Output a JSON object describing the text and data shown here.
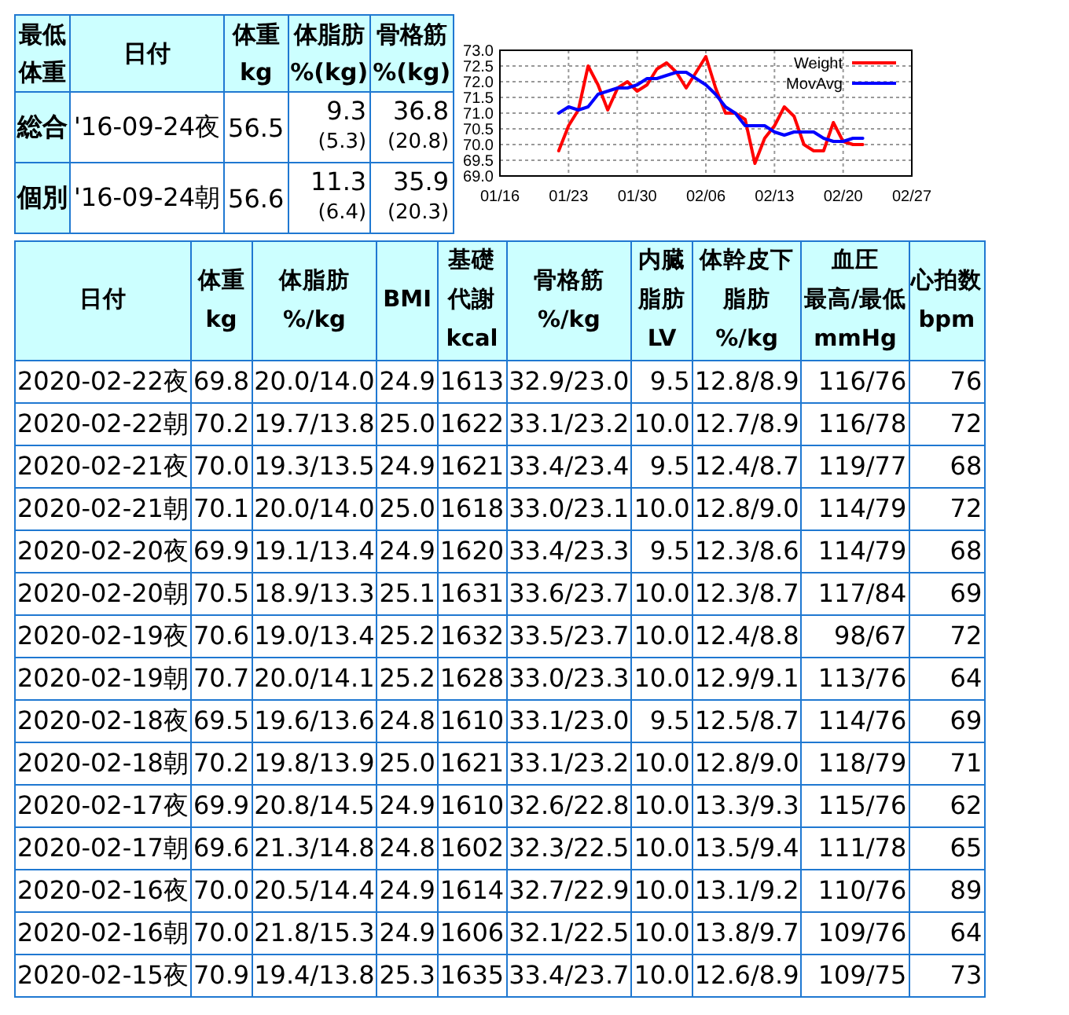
{
  "summary_table": {
    "corner": {
      "lines": [
        "最低",
        "体重"
      ]
    },
    "columns": [
      {
        "lines": [
          "日付"
        ]
      },
      {
        "lines": [
          "体重",
          "kg"
        ]
      },
      {
        "lines": [
          "体脂肪",
          "%(kg)"
        ]
      },
      {
        "lines": [
          "骨格筋",
          "%(kg)"
        ]
      }
    ],
    "rows": [
      {
        "label": "総合",
        "date": "'16-09-24夜",
        "weight": "56.5",
        "fat": "9.3",
        "fat_kg": "(5.3)",
        "muscle": "36.8",
        "muscle_kg": "(20.8)"
      },
      {
        "label": "個別",
        "date": "'16-09-24朝",
        "weight": "56.6",
        "fat": "11.3",
        "fat_kg": "(6.4)",
        "muscle": "35.9",
        "muscle_kg": "(20.3)"
      }
    ]
  },
  "chart": {
    "chart_data": {
      "type": "line",
      "grid": true,
      "legend": true,
      "categories": [
        "01/16",
        null,
        null,
        null,
        null,
        null,
        null,
        "01/23",
        null,
        null,
        null,
        null,
        null,
        null,
        "01/30",
        null,
        null,
        null,
        null,
        null,
        null,
        "02/06",
        null,
        null,
        null,
        null,
        null,
        null,
        "02/13",
        null,
        null,
        null,
        null,
        null,
        null,
        "02/20",
        null,
        null,
        null,
        null,
        null,
        null,
        "02/27"
      ],
      "series": [
        {
          "name": "Weight",
          "color": "#ff0000",
          "values": [
            null,
            null,
            null,
            null,
            null,
            null,
            69.8,
            70.6,
            71.1,
            72.5,
            71.9,
            71.1,
            71.8,
            72.0,
            71.7,
            71.9,
            72.4,
            72.6,
            72.3,
            71.8,
            72.3,
            72.8,
            71.8,
            71.0,
            71.0,
            70.8,
            69.4,
            70.2,
            70.6,
            71.2,
            70.9,
            70.0,
            69.8,
            69.8,
            70.7,
            70.1,
            70.0,
            70.0,
            null,
            null,
            null,
            null,
            null
          ]
        },
        {
          "name": "MovAvg",
          "color": "#0000ff",
          "values": [
            null,
            null,
            null,
            null,
            null,
            null,
            71.0,
            71.2,
            71.1,
            71.2,
            71.6,
            71.7,
            71.8,
            71.8,
            71.9,
            72.1,
            72.1,
            72.2,
            72.3,
            72.3,
            72.1,
            71.9,
            71.6,
            71.2,
            71.0,
            70.6,
            70.6,
            70.6,
            70.4,
            70.3,
            70.4,
            70.4,
            70.4,
            70.2,
            70.1,
            70.1,
            70.2,
            70.2,
            null,
            null,
            null,
            null,
            null
          ]
        }
      ],
      "ylim": [
        69.0,
        73.0
      ],
      "yticks": [
        {
          "value": 69.0,
          "label": "69.0"
        },
        {
          "value": 69.5,
          "label": "69.5"
        },
        {
          "value": 70.0,
          "label": "70.0"
        },
        {
          "value": 70.5,
          "label": "70.5"
        },
        {
          "value": 71.0,
          "label": "71.0"
        },
        {
          "value": 71.5,
          "label": "71.5"
        },
        {
          "value": 72.0,
          "label": "72.0"
        },
        {
          "value": 72.5,
          "label": "72.5"
        },
        {
          "value": 73.0,
          "label": "73.0"
        }
      ]
    }
  },
  "log_table": {
    "columns": [
      {
        "lines": [
          "日付"
        ]
      },
      {
        "lines": [
          "体重",
          "kg"
        ]
      },
      {
        "lines": [
          "体脂肪",
          "%/kg"
        ]
      },
      {
        "lines": [
          "BMI"
        ]
      },
      {
        "lines": [
          "基礎",
          "代謝",
          "kcal"
        ]
      },
      {
        "lines": [
          "骨格筋",
          "%/kg"
        ]
      },
      {
        "lines": [
          "内臓",
          "脂肪",
          "LV"
        ]
      },
      {
        "lines": [
          "体幹皮下",
          "脂肪",
          "%/kg"
        ]
      },
      {
        "lines": [
          "血圧",
          "最高/最低",
          "mmHg"
        ]
      },
      {
        "lines": [
          "心拍数",
          "bpm"
        ]
      }
    ],
    "rows": [
      [
        "2020-02-22夜",
        "69.8",
        "20.0/14.0",
        "24.9",
        "1613",
        "32.9/23.0",
        "9.5",
        "12.8/8.9",
        "116/76",
        "76"
      ],
      [
        "2020-02-22朝",
        "70.2",
        "19.7/13.8",
        "25.0",
        "1622",
        "33.1/23.2",
        "10.0",
        "12.7/8.9",
        "116/78",
        "72"
      ],
      [
        "2020-02-21夜",
        "70.0",
        "19.3/13.5",
        "24.9",
        "1621",
        "33.4/23.4",
        "9.5",
        "12.4/8.7",
        "119/77",
        "68"
      ],
      [
        "2020-02-21朝",
        "70.1",
        "20.0/14.0",
        "25.0",
        "1618",
        "33.0/23.1",
        "10.0",
        "12.8/9.0",
        "114/79",
        "72"
      ],
      [
        "2020-02-20夜",
        "69.9",
        "19.1/13.4",
        "24.9",
        "1620",
        "33.4/23.3",
        "9.5",
        "12.3/8.6",
        "114/79",
        "68"
      ],
      [
        "2020-02-20朝",
        "70.5",
        "18.9/13.3",
        "25.1",
        "1631",
        "33.6/23.7",
        "10.0",
        "12.3/8.7",
        "117/84",
        "69"
      ],
      [
        "2020-02-19夜",
        "70.6",
        "19.0/13.4",
        "25.2",
        "1632",
        "33.5/23.7",
        "10.0",
        "12.4/8.8",
        "98/67",
        "72"
      ],
      [
        "2020-02-19朝",
        "70.7",
        "20.0/14.1",
        "25.2",
        "1628",
        "33.0/23.3",
        "10.0",
        "12.9/9.1",
        "113/76",
        "64"
      ],
      [
        "2020-02-18夜",
        "69.5",
        "19.6/13.6",
        "24.8",
        "1610",
        "33.1/23.0",
        "9.5",
        "12.5/8.7",
        "114/76",
        "69"
      ],
      [
        "2020-02-18朝",
        "70.2",
        "19.8/13.9",
        "25.0",
        "1621",
        "33.1/23.2",
        "10.0",
        "12.8/9.0",
        "118/79",
        "71"
      ],
      [
        "2020-02-17夜",
        "69.9",
        "20.8/14.5",
        "24.9",
        "1610",
        "32.6/22.8",
        "10.0",
        "13.3/9.3",
        "115/76",
        "62"
      ],
      [
        "2020-02-17朝",
        "69.6",
        "21.3/14.8",
        "24.8",
        "1602",
        "32.3/22.5",
        "10.0",
        "13.5/9.4",
        "111/78",
        "65"
      ],
      [
        "2020-02-16夜",
        "70.0",
        "20.5/14.4",
        "24.9",
        "1614",
        "32.7/22.9",
        "10.0",
        "13.1/9.2",
        "110/76",
        "89"
      ],
      [
        "2020-02-16朝",
        "70.0",
        "21.8/15.3",
        "24.9",
        "1606",
        "32.1/22.5",
        "10.0",
        "13.8/9.7",
        "109/76",
        "64"
      ],
      [
        "2020-02-15夜",
        "70.9",
        "19.4/13.8",
        "25.3",
        "1635",
        "33.4/23.7",
        "10.0",
        "12.6/8.9",
        "109/75",
        "73"
      ]
    ]
  }
}
